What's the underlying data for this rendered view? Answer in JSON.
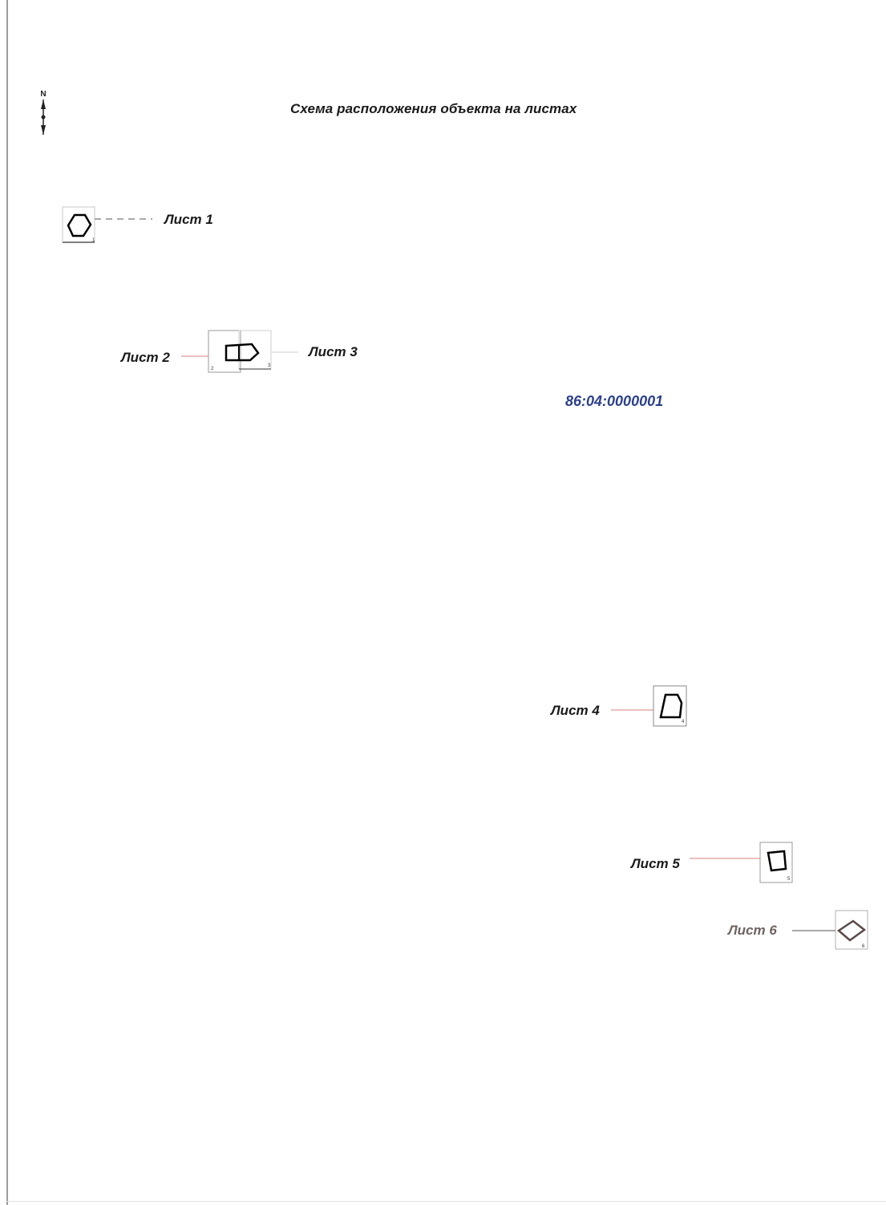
{
  "title": "Схема расположения объекта на листах",
  "cadastral_number": "86:04:0000001",
  "north_arrow": {
    "letter": "N"
  },
  "sheets": [
    {
      "label": "Лист 1",
      "number": "1"
    },
    {
      "label": "Лист 2",
      "number": "2"
    },
    {
      "label": "Лист 3",
      "number": "3"
    },
    {
      "label": "Лист 4",
      "number": "4"
    },
    {
      "label": "Лист 5",
      "number": "5"
    },
    {
      "label": "Лист 6",
      "number": "6"
    }
  ],
  "colors": {
    "cadastral_text": "#2b3f8c",
    "leader_line_red": "#d9827e",
    "leader_line_dark": "#555555",
    "sheet6_label": "#6e6462",
    "frame": "#9c9c9c"
  }
}
